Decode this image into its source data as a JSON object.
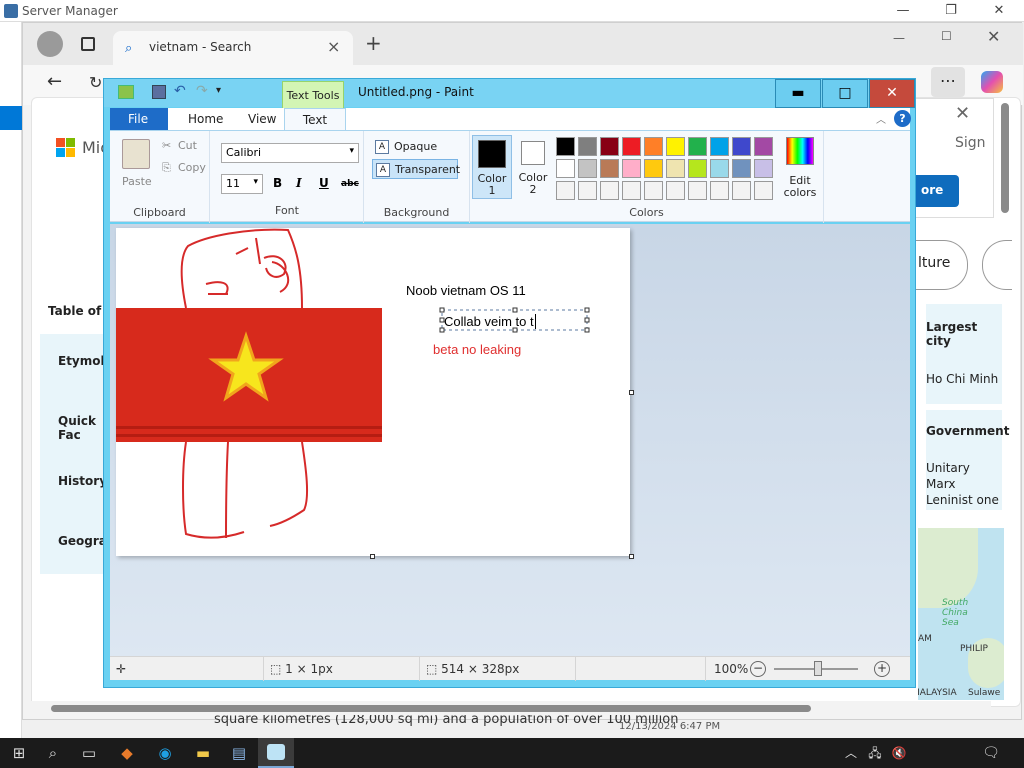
{
  "server_manager": {
    "title": "Server Manager"
  },
  "browser": {
    "tab_title": "vietnam - Search",
    "page": {
      "logo_text": "Mic",
      "sign_in": "Sign",
      "more_button": "ore",
      "culture_chip": "lture",
      "toc": "Table of C",
      "nav": [
        "Etymology",
        "Quick Fac",
        "History",
        "Geography"
      ],
      "largest_city_label": "Largest city",
      "largest_city_value": "Ho Chi Minh",
      "government_label": "Government",
      "government_value": "Unitary Marx Leninist one",
      "bottom_text": "square kilometres (128,000 sq mi) and a population of over 100 million",
      "timestamp": "12/13/2024 6:47 PM",
      "map_labels": {
        "sea": "South China Sea",
        "cambodia": "AM",
        "philippines": "PHILIP",
        "malaysia": "MALAYSIA",
        "sulawesi": "Sulawe"
      }
    }
  },
  "paint": {
    "title": "Untitled.png - Paint",
    "contextual_tab": "Text Tools",
    "tabs": [
      "File",
      "Home",
      "View",
      "Text"
    ],
    "clipboard": {
      "paste": "Paste",
      "cut": "Cut",
      "copy": "Copy",
      "label": "Clipboard"
    },
    "font": {
      "family": "Calibri",
      "size": "11",
      "bold": "B",
      "italic": "I",
      "underline": "U",
      "strike": "abc",
      "label": "Font"
    },
    "background": {
      "opaque": "Opaque",
      "transparent": "Transparent",
      "label": "Background"
    },
    "colors": {
      "color1": "Color 1",
      "color2": "Color 2",
      "edit": "Edit colors",
      "label": "Colors",
      "palette_row1": [
        "#000000",
        "#7f7f7f",
        "#880015",
        "#ed1c24",
        "#ff7f27",
        "#fff200",
        "#22b14c",
        "#00a2e8",
        "#3f48cc",
        "#a349a4"
      ],
      "palette_row2": [
        "#ffffff",
        "#c3c3c3",
        "#b97a57",
        "#ffaec9",
        "#ffc90e",
        "#efe4b0",
        "#b5e61d",
        "#99d9ea",
        "#7092be",
        "#c8bfe7"
      ]
    },
    "canvas_text": {
      "line1": "Noob vietnam OS 11",
      "line2": "Collab veim to t",
      "line3": "beta no leaking"
    },
    "status": {
      "selection": "1 × 1px",
      "size": "514 × 328px",
      "zoom": "100%"
    }
  }
}
